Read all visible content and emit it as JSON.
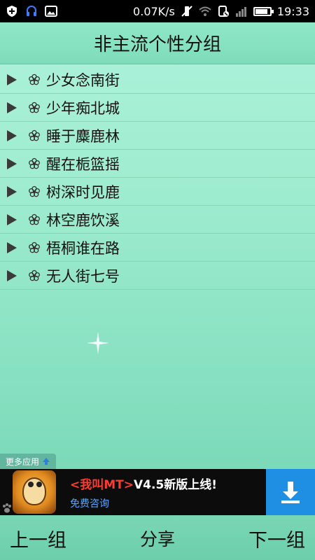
{
  "status_bar": {
    "speed": "0.07K/s",
    "time": "19:33"
  },
  "title": "非主流个性分组",
  "groups": [
    {
      "label": "少女念南街"
    },
    {
      "label": "少年痴北城"
    },
    {
      "label": "睡于麋鹿林"
    },
    {
      "label": "醒在栀篮摇"
    },
    {
      "label": "树深时见鹿"
    },
    {
      "label": "林空鹿饮溪"
    },
    {
      "label": "梧桐谁在路"
    },
    {
      "label": "无人街七号"
    }
  ],
  "ad": {
    "more_apps": "更多应用",
    "title_accent": "<我叫MT>",
    "title_rest": "V4.5新版上线!",
    "subtitle": "免费咨询"
  },
  "bottom_bar": {
    "prev": "上一组",
    "share": "分享",
    "next": "下一组"
  },
  "colors": {
    "accent_red": "#ff3b30",
    "download_blue": "#1e8fe3",
    "background": "#9eeccf"
  }
}
